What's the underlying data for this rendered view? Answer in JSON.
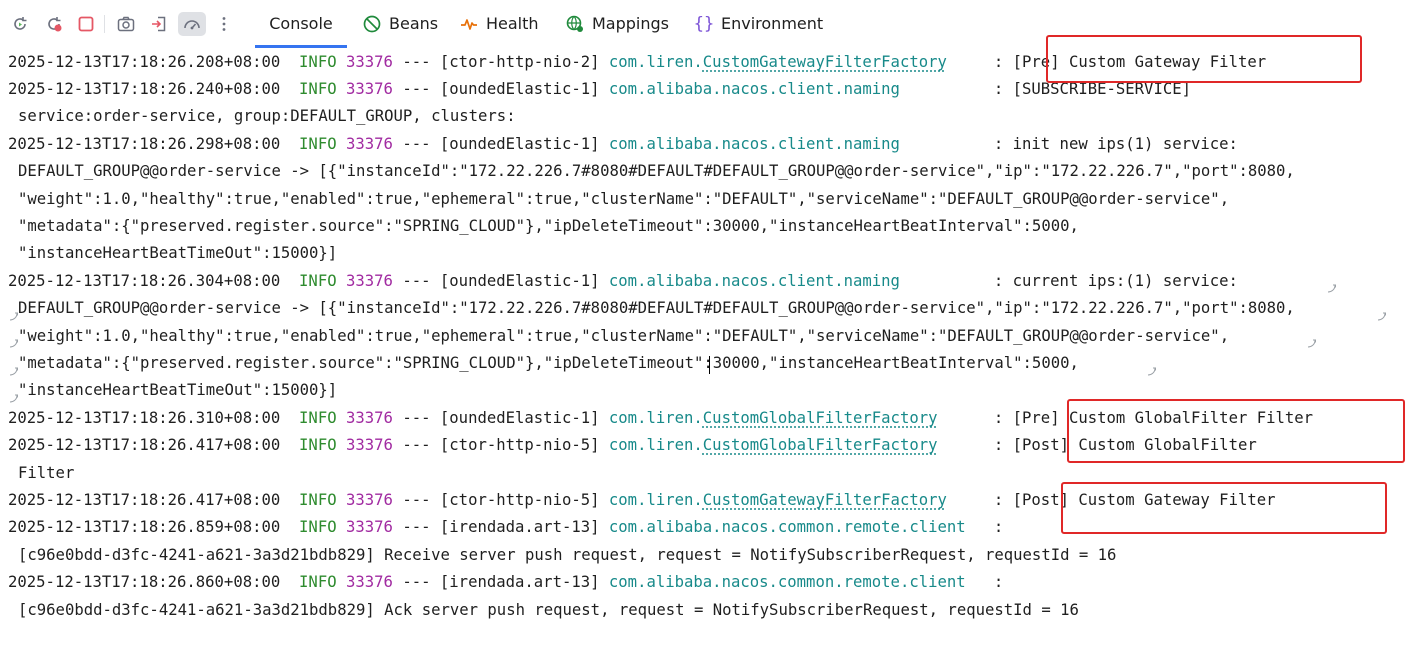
{
  "toolbar": {
    "icons": [
      "rerun-icon",
      "rerun-failed-icon",
      "stop-icon",
      "screenshot-icon",
      "exit-icon",
      "dashboard-icon",
      "more-icon"
    ],
    "tabs": [
      {
        "label": "Console",
        "icon": "console"
      },
      {
        "label": "Beans",
        "icon": "beans-icon"
      },
      {
        "label": "Health",
        "icon": "health-icon"
      },
      {
        "label": "Mappings",
        "icon": "mappings-icon"
      },
      {
        "label": "Environment",
        "icon": "environment-icon"
      }
    ],
    "selected_tab": "Console"
  },
  "colors": {
    "info": "#2e8b2e",
    "pid": "#a12ba1",
    "logger": "#188a8a",
    "highlight": "#e02828",
    "tab_underline": "#3574f0"
  },
  "log": [
    {
      "ts": "2025-12-13T17:18:26.208+08:00",
      "level": "INFO",
      "pid": "33376",
      "sep": "---",
      "thread": "[ctor-http-nio-2]",
      "pkg": "com.liren.",
      "cls": "CustomGatewayFilterFactory",
      "msg": ": [Pre] Custom Gateway Filter"
    },
    {
      "ts": "2025-12-13T17:18:26.240+08:00",
      "level": "INFO",
      "pid": "33376",
      "sep": "---",
      "thread": "[oundedElastic-1]",
      "pkg": "com.alibaba.nacos.client.naming",
      "cls": "",
      "msg": ": [SUBSCRIBE-SERVICE]"
    },
    {
      "cont": "service:order-service, group:DEFAULT_GROUP, clusters:"
    },
    {
      "ts": "2025-12-13T17:18:26.298+08:00",
      "level": "INFO",
      "pid": "33376",
      "sep": "---",
      "thread": "[oundedElastic-1]",
      "pkg": "com.alibaba.nacos.client.naming",
      "cls": "",
      "msg": ": init new ips(1) service:"
    },
    {
      "cont": "DEFAULT_GROUP@@order-service -> [{\"instanceId\":\"172.22.226.7#8080#DEFAULT#DEFAULT_GROUP@@order-service\",\"ip\":\"172.22.226.7\",\"port\":8080,"
    },
    {
      "cont": "\"weight\":1.0,\"healthy\":true,\"enabled\":true,\"ephemeral\":true,\"clusterName\":\"DEFAULT\",\"serviceName\":\"DEFAULT_GROUP@@order-service\","
    },
    {
      "cont": "\"metadata\":{\"preserved.register.source\":\"SPRING_CLOUD\"},\"ipDeleteTimeout\":30000,\"instanceHeartBeatInterval\":5000,"
    },
    {
      "cont": "\"instanceHeartBeatTimeOut\":15000}]"
    },
    {
      "ts": "2025-12-13T17:18:26.304+08:00",
      "level": "INFO",
      "pid": "33376",
      "sep": "---",
      "thread": "[oundedElastic-1]",
      "pkg": "com.alibaba.nacos.client.naming",
      "cls": "",
      "msg": ": current ips:(1) service:"
    },
    {
      "cont": "DEFAULT_GROUP@@order-service -> [{\"instanceId\":\"172.22.226.7#8080#DEFAULT#DEFAULT_GROUP@@order-service\",\"ip\":\"172.22.226.7\",\"port\":8080,"
    },
    {
      "cont": "\"weight\":1.0,\"healthy\":true,\"enabled\":true,\"ephemeral\":true,\"clusterName\":\"DEFAULT\",\"serviceName\":\"DEFAULT_GROUP@@order-service\","
    },
    {
      "cont": "\"metadata\":{\"preserved.register.source\":\"SPRING_CLOUD\"},\"ipDeleteTimeout\":30000,\"instanceHeartBeatInterval\":5000,"
    },
    {
      "cont": "\"instanceHeartBeatTimeOut\":15000}]"
    },
    {
      "ts": "2025-12-13T17:18:26.310+08:00",
      "level": "INFO",
      "pid": "33376",
      "sep": "---",
      "thread": "[oundedElastic-1]",
      "pkg": "com.liren.",
      "cls": "CustomGlobalFilterFactory",
      "msg": ": [Pre] Custom GlobalFilter Filter"
    },
    {
      "ts": "2025-12-13T17:18:26.417+08:00",
      "level": "INFO",
      "pid": "33376",
      "sep": "---",
      "thread": "[ctor-http-nio-5]",
      "pkg": "com.liren.",
      "cls": "CustomGlobalFilterFactory",
      "msg": ": [Post] Custom GlobalFilter"
    },
    {
      "cont": "Filter"
    },
    {
      "ts": "2025-12-13T17:18:26.417+08:00",
      "level": "INFO",
      "pid": "33376",
      "sep": "---",
      "thread": "[ctor-http-nio-5]",
      "pkg": "com.liren.",
      "cls": "CustomGatewayFilterFactory",
      "msg": ": [Post] Custom Gateway Filter"
    },
    {
      "ts": "2025-12-13T17:18:26.859+08:00",
      "level": "INFO",
      "pid": "33376",
      "sep": "---",
      "thread": "[irendada.art-13]",
      "pkg": "com.alibaba.nacos.common.remote.client",
      "cls": "",
      "msg": ":"
    },
    {
      "cont": "[c96e0bdd-d3fc-4241-a621-3a3d21bdb829] Receive server push request, request = NotifySubscriberRequest, requestId = 16"
    },
    {
      "ts": "2025-12-13T17:18:26.860+08:00",
      "level": "INFO",
      "pid": "33376",
      "sep": "---",
      "thread": "[irendada.art-13]",
      "pkg": "com.alibaba.nacos.common.remote.client",
      "cls": "",
      "msg": ":"
    },
    {
      "cont": "[c96e0bdd-d3fc-4241-a621-3a3d21bdb829] Ack server push request, request = NotifySubscriberRequest, requestId = 16"
    }
  ]
}
